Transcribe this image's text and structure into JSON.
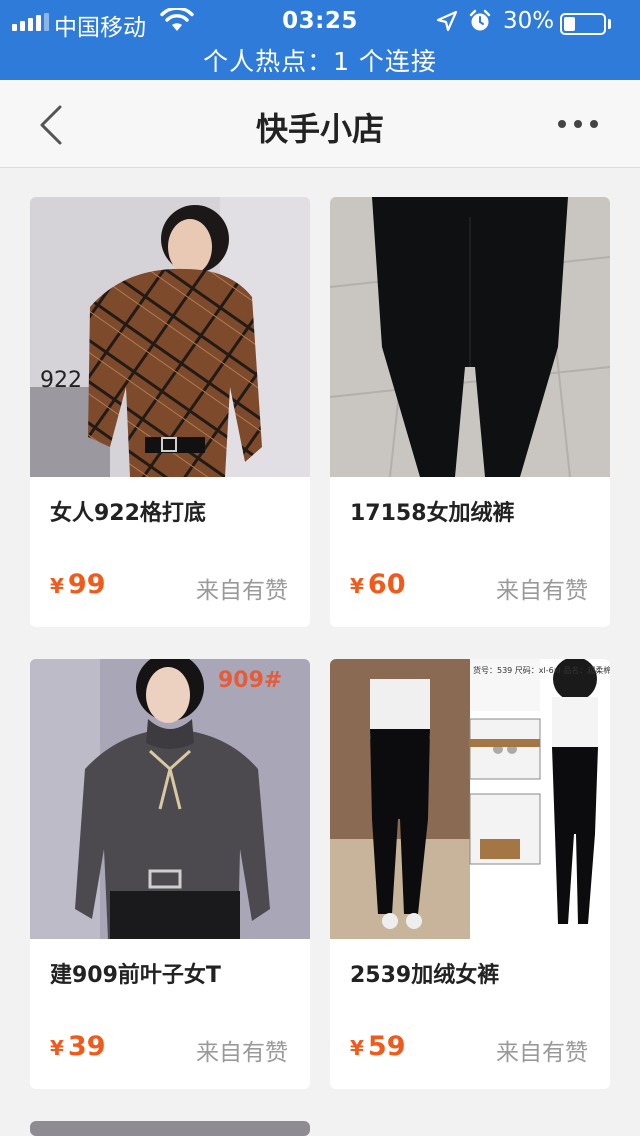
{
  "status_bar": {
    "carrier": "中国移动",
    "time": "03:25",
    "battery_percent": "30%",
    "battery_level": 0.3,
    "signal_bars": 4,
    "hotspot": "个人热点：1 个连接"
  },
  "nav": {
    "title": "快手小店"
  },
  "products": [
    {
      "name": "女人922格打底",
      "currency": "¥",
      "price": "99",
      "source": "来自有赞",
      "image_label": "922",
      "image_icon": "plaid-top-icon"
    },
    {
      "name": "17158女加绒裤",
      "currency": "¥",
      "price": "60",
      "source": "来自有赞",
      "image_icon": "black-pants-icon"
    },
    {
      "name": "建909前叶子女T",
      "currency": "¥",
      "price": "39",
      "source": "来自有赞",
      "image_label": "909#",
      "image_icon": "grey-top-icon"
    },
    {
      "name": "2539加绒女裤",
      "currency": "¥",
      "price": "59",
      "source": "来自有赞",
      "image_label": "货号：539 尺码：xl-6xl 品名：超柔棉裤",
      "image_icon": "fleece-pants-collage-icon"
    }
  ],
  "colors": {
    "status_bar": "#2f7bd9",
    "price": "#f25a1b",
    "source": "#9a9a9a",
    "page_bg": "#f2f2f2"
  }
}
